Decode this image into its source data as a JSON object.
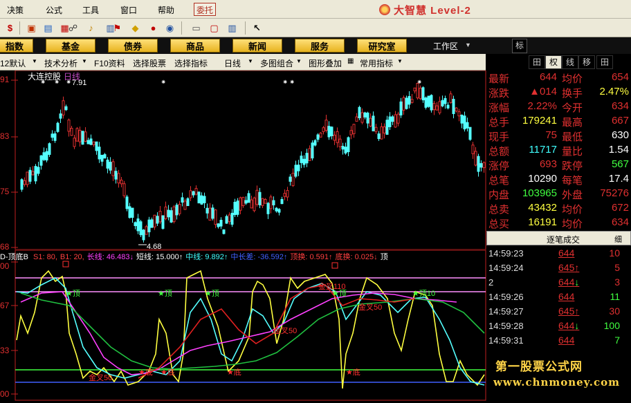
{
  "menubar": {
    "items": [
      "决策",
      "公式",
      "工具",
      "窗口",
      "帮助"
    ],
    "highlight": "委托",
    "brand": "大智慧 Level-2"
  },
  "category_bar": {
    "items": [
      "指数",
      "基金",
      "债券",
      "商品",
      "新闻",
      "服务",
      "研究室"
    ],
    "workspace": "工作区"
  },
  "subtoolbar": {
    "items": [
      "12默认",
      "技术分析",
      "F10资料",
      "选择股票",
      "选择指标",
      "日线",
      "多图组合",
      "图形叠加",
      "常用指标"
    ]
  },
  "side_tabs": [
    "标",
    "田",
    "权",
    "线",
    "移",
    "田"
  ],
  "kline": {
    "stock_name": "大连控股",
    "period": "日线",
    "y_labels": [
      "91",
      "83",
      "75",
      "68"
    ],
    "high_label": "7.91",
    "low_label": "4.68"
  },
  "indicator": {
    "name": "D-顶底B",
    "params": [
      {
        "text": "S1: 80,",
        "color": "#ff4040"
      },
      {
        "text": "B1: 20,",
        "color": "#ff4040"
      },
      {
        "text": "长线: 46.483↓",
        "color": "#ff40ff"
      },
      {
        "text": "短线: 15.000↑",
        "color": "#ffffff"
      },
      {
        "text": "中线: 9.892↑",
        "color": "#40ffff"
      },
      {
        "text": "中长差: -36.592↑",
        "color": "#4060ff"
      },
      {
        "text": "顶换: 0.591↑",
        "color": "#ff4040"
      },
      {
        "text": "底换: 0.025↓",
        "color": "#ff4040"
      },
      {
        "text": "顶",
        "color": "#ffffff"
      }
    ],
    "y_labels": [
      "00",
      "67",
      "33",
      "00"
    ],
    "markers": [
      {
        "text": "★顶",
        "color": "#40ff40"
      },
      {
        "text": "★顶",
        "color": "#40ff40"
      },
      {
        "text": "★顶",
        "color": "#40ff40"
      },
      {
        "text": "★顶",
        "color": "#40ff40"
      },
      {
        "text": "★顶10",
        "color": "#40ff40"
      },
      {
        "text": "★底",
        "color": "#ff3030"
      },
      {
        "text": "★底",
        "color": "#ff3030"
      },
      {
        "text": "★底",
        "color": "#ff3030"
      },
      {
        "text": "★底",
        "color": "#ff3030"
      },
      {
        "text": "金叉50",
        "color": "#ff3030"
      },
      {
        "text": "金叉50",
        "color": "#ff3030"
      },
      {
        "text": "金叉50",
        "color": "#ff3030"
      },
      {
        "text": "金叉110",
        "color": "#ff3030"
      }
    ]
  },
  "quote": {
    "rows": [
      {
        "l": "最新",
        "v": "644",
        "vc": "#e03030",
        "l2": "均价",
        "v2": "654",
        "v2c": "#e03030"
      },
      {
        "l": "涨跌",
        "v": "▲014",
        "vc": "#e03030",
        "l2": "换手",
        "v2": "2.47%",
        "v2c": "#ffff40"
      },
      {
        "l": "涨幅",
        "v": "2.22%",
        "vc": "#e03030",
        "l2": "今开",
        "v2": "634",
        "v2c": "#e03030"
      },
      {
        "l": "总手",
        "v": "179241",
        "vc": "#ffff40",
        "l2": "最高",
        "v2": "667",
        "v2c": "#e03030"
      },
      {
        "l": "现手",
        "v": "75",
        "vc": "#e03030",
        "l2": "最低",
        "v2": "630",
        "v2c": "#ffffff"
      },
      {
        "l": "总额",
        "v": "11717",
        "vc": "#40ffff",
        "l2": "量比",
        "v2": "1.54",
        "v2c": "#ffffff"
      },
      {
        "l": "涨停",
        "v": "693",
        "vc": "#e03030",
        "l2": "跌停",
        "v2": "567",
        "v2c": "#40ff40"
      },
      {
        "l": "总笔",
        "v": "10290",
        "vc": "#ffffff",
        "l2": "每笔",
        "v2": "17.4",
        "v2c": "#ffffff"
      },
      {
        "l": "内盘",
        "v": "103965",
        "vc": "#40ff40",
        "l2": "外盘",
        "v2": "75276",
        "v2c": "#e03030"
      },
      {
        "l": "总卖",
        "v": "43432",
        "vc": "#ffff40",
        "l2": "均价",
        "v2": "672",
        "v2c": "#e03030"
      },
      {
        "l": "总买",
        "v": "16191",
        "vc": "#ffff40",
        "l2": "均价",
        "v2": "634",
        "v2c": "#e03030"
      }
    ]
  },
  "trades": {
    "title": "逐笔成交",
    "button": "细",
    "rows": [
      {
        "time": "14:59:23",
        "price": "644",
        "arrow": "",
        "vol": "10",
        "vc": "#e03030"
      },
      {
        "time": "14:59:24",
        "price": "645",
        "arrow": "↑",
        "vol": "5",
        "vc": "#e03030"
      },
      {
        "time": "2",
        "price": "644",
        "arrow": "↓",
        "vol": "3",
        "vc": "#e03030"
      },
      {
        "time": "14:59:26",
        "price": "644",
        "arrow": "",
        "vol": "11",
        "vc": "#40ff40"
      },
      {
        "time": "14:59:27",
        "price": "645",
        "arrow": "↑",
        "vol": "30",
        "vc": "#e03030"
      },
      {
        "time": "14:59:28",
        "price": "644",
        "arrow": "↓",
        "vol": "100",
        "vc": "#40ff40"
      },
      {
        "time": "14:59:31",
        "price": "644",
        "arrow": "",
        "vol": "7",
        "vc": "#40ff40"
      }
    ]
  },
  "watermark": {
    "line1": "第一股票公式网",
    "line2": "www.chnmoney.com"
  }
}
